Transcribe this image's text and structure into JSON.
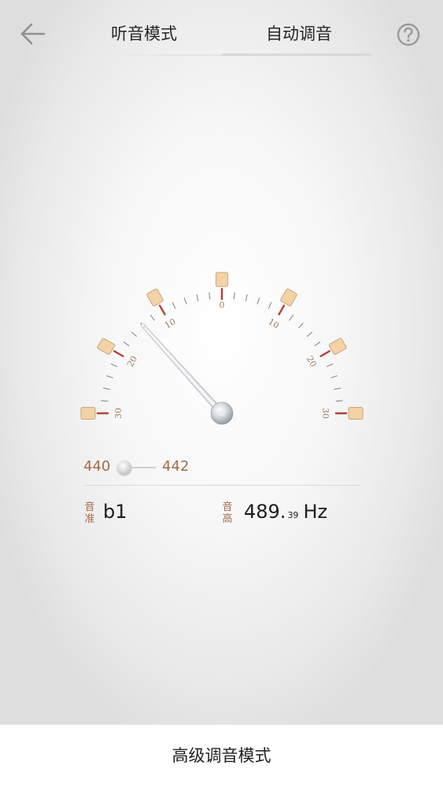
{
  "header": {
    "back_icon": "arrow-left-icon",
    "tabs": [
      {
        "label": "听音模式",
        "active": false
      },
      {
        "label": "自动调音",
        "active": true
      }
    ],
    "help_icon": "question-circle-icon"
  },
  "gauge": {
    "scale_labels": [
      "30",
      "20",
      "10",
      "0",
      "10",
      "20",
      "30"
    ],
    "needle_value": -14,
    "colors": {
      "marker_fill": "#f3d3a6",
      "marker_stroke": "#c9a57a",
      "major_tick": "#b0423a",
      "minor_tick": "#8a8a8a",
      "label": "#9a7d67"
    }
  },
  "reference": {
    "low": "440",
    "high": "442",
    "slider_icon": "slider-knob-icon"
  },
  "note": {
    "label_line1": "音",
    "label_line2": "准",
    "value": "b1"
  },
  "pitch": {
    "label_line1": "音",
    "label_line2": "高",
    "value_main": "489.",
    "value_decimal": "39",
    "unit": "Hz"
  },
  "footer": {
    "advanced_label": "高级调音模式"
  }
}
